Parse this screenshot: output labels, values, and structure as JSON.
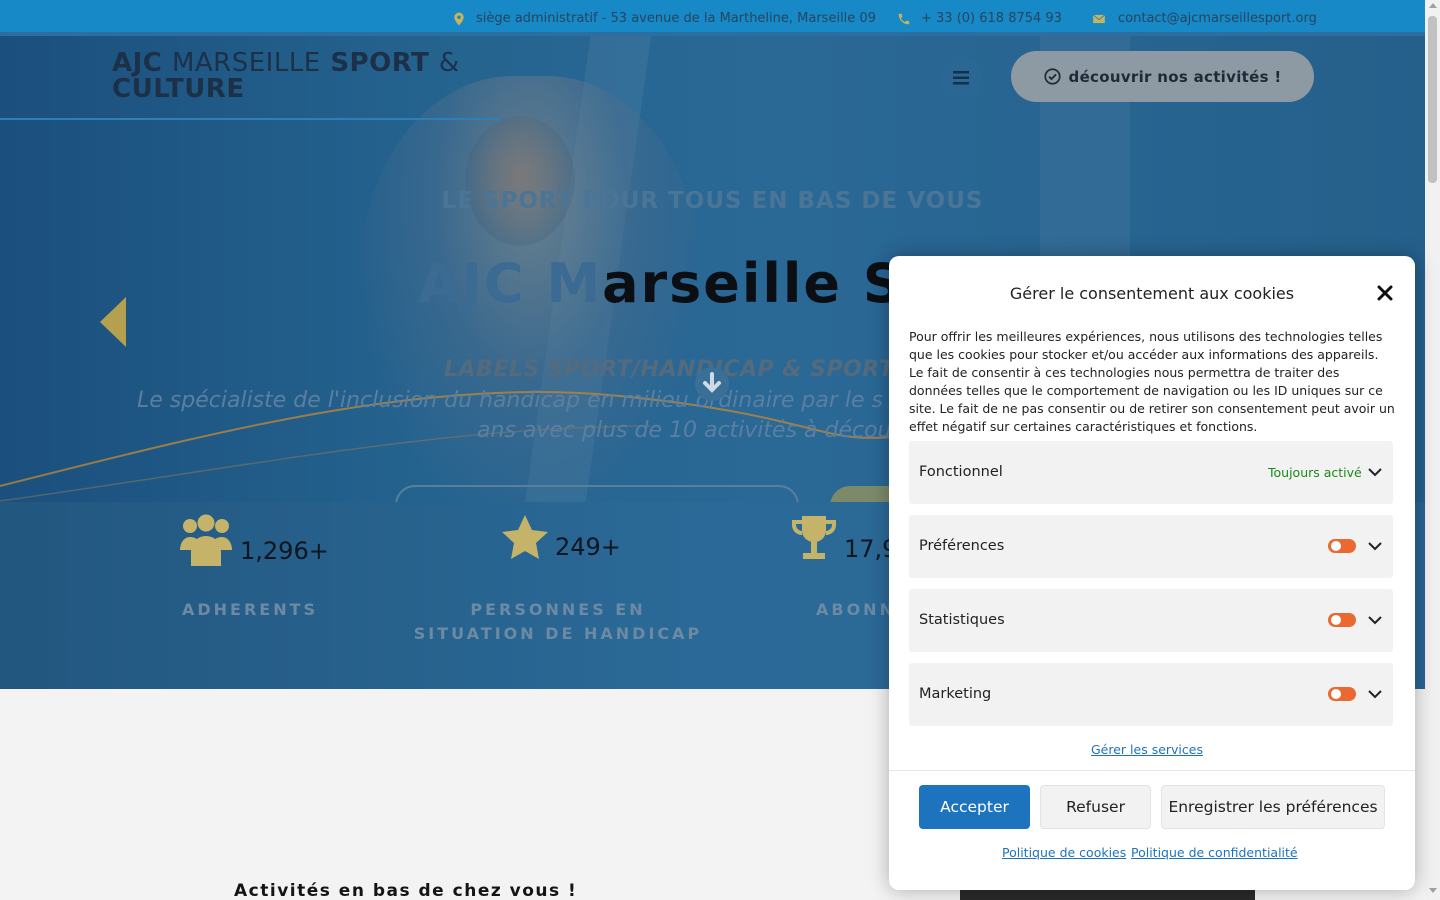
{
  "topbar": {
    "address": "siège administratif - 53 avenue de la Martheline, Marseille 09",
    "phone": "+ 33 (0) 618 8754 93",
    "email": "contact@ajcmarseillesport.org"
  },
  "header": {
    "logo_part1": "AJC",
    "logo_part2": "MARSEILLE",
    "logo_part3": "SPORT",
    "logo_part4": "&",
    "logo_line2": "CULTURE",
    "cta_label": "découvrir nos activités !"
  },
  "hero": {
    "tagline": "LE SPORT POUR TOUS EN BAS DE VOUS",
    "title_faded": "AJC M",
    "title_solid": "arseille Sp",
    "labels": "LABELS SPORT/HANDICAP & SPORT/",
    "desc_line1": "Le spécialiste de l'inclusion du handicap en milieu ordinaire par le s",
    "desc_line2": "ans avec plus de 10 activités à décou"
  },
  "stats": [
    {
      "number": "1,296+",
      "label_line1": "ADHERENTS",
      "label_line2": ""
    },
    {
      "number": "249+",
      "label_line1": "PERSONNES EN",
      "label_line2": "SITUATION DE HANDICAP"
    },
    {
      "number": "17,9",
      "label_line1": "ABONN",
      "label_line2": ""
    }
  ],
  "section": {
    "title": "Activités en bas de chez vous !"
  },
  "cookie": {
    "title": "Gérer le consentement aux cookies",
    "text": "Pour offrir les meilleures expériences, nous utilisons des technologies telles que les cookies pour stocker et/ou accéder aux informations des appareils. Le fait de consentir à ces technologies nous permettra de traiter des données telles que le comportement de navigation ou les ID uniques sur ce site. Le fait de ne pas consentir ou de retirer son consentement peut avoir un effet négatif sur certaines caractéristiques et fonctions.",
    "categories": [
      {
        "name": "Fonctionnel",
        "status": "Toujours activé"
      },
      {
        "name": "Préférences"
      },
      {
        "name": "Statistiques"
      },
      {
        "name": "Marketing"
      }
    ],
    "manage_services": "Gérer les services",
    "accept": "Accepter",
    "refuse": "Refuser",
    "save": "Enregistrer les préférences",
    "cookie_policy": "Politique de cookies",
    "privacy_policy": "Politique de confidentialité"
  },
  "colors": {
    "accent": "#1e73be",
    "toggle": "#ea6930",
    "topbar": "#1689c6",
    "icon_gold": "#c5b36a"
  }
}
